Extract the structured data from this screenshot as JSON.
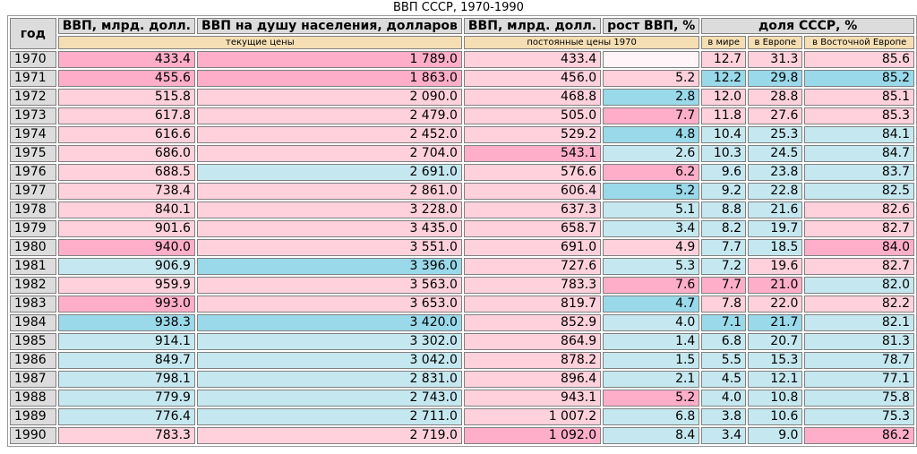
{
  "title": "ВВП СССР, 1970-1990",
  "headers": {
    "year": "год",
    "gdp_current": "ВВП, млрд. долл.",
    "gdp_per_capita": "ВВП на душу населения, долларов",
    "gdp_constant": "ВВП, млрд. долл.",
    "growth": "рост ВВП, %",
    "share": "доля СССР, %",
    "current_prices": "текущие цены",
    "constant_prices": "постоянные цены 1970",
    "share_world": "в мире",
    "share_europe": "в Европе",
    "share_east_europe": "в Восточной Европе"
  },
  "rows": [
    {
      "year": "1970",
      "gdp": "433.4",
      "pc": "1 789.0",
      "const": "433.4",
      "growth": "",
      "world": "12.7",
      "europe": "31.3",
      "east": "85.6",
      "cls": [
        "c-hot",
        "c-hot",
        "c-pink",
        "c-white",
        "c-pink",
        "c-pink",
        "c-pink"
      ]
    },
    {
      "year": "1971",
      "gdp": "455.6",
      "pc": "1 863.0",
      "const": "456.0",
      "growth": "5.2",
      "world": "12.2",
      "europe": "29.8",
      "east": "85.2",
      "cls": [
        "c-hot",
        "c-hot",
        "c-pink",
        "c-pink",
        "c-deep",
        "c-deep",
        "c-deep"
      ]
    },
    {
      "year": "1972",
      "gdp": "515.8",
      "pc": "2 090.0",
      "const": "468.8",
      "growth": "2.8",
      "world": "12.0",
      "europe": "28.8",
      "east": "85.1",
      "cls": [
        "c-pink",
        "c-pink",
        "c-pink",
        "c-deep",
        "c-pink",
        "c-pink",
        "c-pink"
      ]
    },
    {
      "year": "1973",
      "gdp": "617.8",
      "pc": "2 479.0",
      "const": "505.0",
      "growth": "7.7",
      "world": "11.8",
      "europe": "27.6",
      "east": "85.3",
      "cls": [
        "c-pink",
        "c-pink",
        "c-pink",
        "c-hot",
        "c-pink",
        "c-pink",
        "c-pink"
      ]
    },
    {
      "year": "1974",
      "gdp": "616.6",
      "pc": "2 452.0",
      "const": "529.2",
      "growth": "4.8",
      "world": "10.4",
      "europe": "25.3",
      "east": "84.1",
      "cls": [
        "c-pink",
        "c-pink",
        "c-pink",
        "c-deep",
        "c-blue",
        "c-blue",
        "c-blue"
      ]
    },
    {
      "year": "1975",
      "gdp": "686.0",
      "pc": "2 704.0",
      "const": "543.1",
      "growth": "2.6",
      "world": "10.3",
      "europe": "24.5",
      "east": "84.7",
      "cls": [
        "c-pink",
        "c-pink",
        "c-hot",
        "c-blue",
        "c-blue",
        "c-blue",
        "c-blue"
      ]
    },
    {
      "year": "1976",
      "gdp": "688.5",
      "pc": "2 691.0",
      "const": "576.6",
      "growth": "6.2",
      "world": "9.6",
      "europe": "23.8",
      "east": "83.7",
      "cls": [
        "c-pink",
        "c-blue",
        "c-pink",
        "c-hot",
        "c-blue",
        "c-blue",
        "c-blue"
      ]
    },
    {
      "year": "1977",
      "gdp": "738.4",
      "pc": "2 861.0",
      "const": "606.4",
      "growth": "5.2",
      "world": "9.2",
      "europe": "22.8",
      "east": "82.5",
      "cls": [
        "c-pink",
        "c-pink",
        "c-pink",
        "c-deep",
        "c-blue",
        "c-blue",
        "c-blue"
      ]
    },
    {
      "year": "1978",
      "gdp": "840.1",
      "pc": "3 228.0",
      "const": "637.3",
      "growth": "5.1",
      "world": "8.8",
      "europe": "21.6",
      "east": "82.6",
      "cls": [
        "c-pink",
        "c-pink",
        "c-pink",
        "c-blue",
        "c-blue",
        "c-blue",
        "c-pink"
      ]
    },
    {
      "year": "1979",
      "gdp": "901.6",
      "pc": "3 435.0",
      "const": "658.7",
      "growth": "3.4",
      "world": "8.2",
      "europe": "19.7",
      "east": "82.7",
      "cls": [
        "c-pink",
        "c-pink",
        "c-pink",
        "c-blue",
        "c-blue",
        "c-blue",
        "c-pink"
      ]
    },
    {
      "year": "1980",
      "gdp": "940.0",
      "pc": "3 551.0",
      "const": "691.0",
      "growth": "4.9",
      "world": "7.7",
      "europe": "18.5",
      "east": "84.0",
      "cls": [
        "c-hot",
        "c-pink",
        "c-pink",
        "c-pink",
        "c-blue",
        "c-blue",
        "c-hot"
      ]
    },
    {
      "year": "1981",
      "gdp": "906.9",
      "pc": "3 396.0",
      "const": "727.6",
      "growth": "5.3",
      "world": "7.2",
      "europe": "19.6",
      "east": "82.7",
      "cls": [
        "c-blue",
        "c-deep",
        "c-pink",
        "c-blue",
        "c-blue",
        "c-pink",
        "c-pink"
      ]
    },
    {
      "year": "1982",
      "gdp": "959.9",
      "pc": "3 563.0",
      "const": "783.3",
      "growth": "7.6",
      "world": "7.7",
      "europe": "21.0",
      "east": "82.0",
      "cls": [
        "c-pink",
        "c-pink",
        "c-pink",
        "c-hot",
        "c-hot",
        "c-hot",
        "c-blue"
      ]
    },
    {
      "year": "1983",
      "gdp": "993.0",
      "pc": "3 653.0",
      "const": "819.7",
      "growth": "4.7",
      "world": "7.8",
      "europe": "22.0",
      "east": "82.2",
      "cls": [
        "c-hot",
        "c-pink",
        "c-pink",
        "c-deep",
        "c-pink",
        "c-pink",
        "c-pink"
      ]
    },
    {
      "year": "1984",
      "gdp": "938.3",
      "pc": "3 420.0",
      "const": "852.9",
      "growth": "4.0",
      "world": "7.1",
      "europe": "21.7",
      "east": "82.1",
      "cls": [
        "c-deep",
        "c-deep",
        "c-pink",
        "c-blue",
        "c-deep",
        "c-deep",
        "c-blue"
      ]
    },
    {
      "year": "1985",
      "gdp": "914.1",
      "pc": "3 302.0",
      "const": "864.9",
      "growth": "1.4",
      "world": "6.8",
      "europe": "20.7",
      "east": "81.3",
      "cls": [
        "c-blue",
        "c-blue",
        "c-pink",
        "c-blue",
        "c-blue",
        "c-blue",
        "c-blue"
      ]
    },
    {
      "year": "1986",
      "gdp": "849.7",
      "pc": "3 042.0",
      "const": "878.2",
      "growth": "1.5",
      "world": "5.5",
      "europe": "15.3",
      "east": "78.7",
      "cls": [
        "c-blue",
        "c-blue",
        "c-pink",
        "c-blue",
        "c-blue",
        "c-blue",
        "c-blue"
      ]
    },
    {
      "year": "1987",
      "gdp": "798.1",
      "pc": "2 831.0",
      "const": "896.4",
      "growth": "2.1",
      "world": "4.5",
      "europe": "12.1",
      "east": "77.1",
      "cls": [
        "c-blue",
        "c-blue",
        "c-pink",
        "c-blue",
        "c-blue",
        "c-blue",
        "c-blue"
      ]
    },
    {
      "year": "1988",
      "gdp": "779.9",
      "pc": "2 743.0",
      "const": "943.1",
      "growth": "5.2",
      "world": "4.0",
      "europe": "10.8",
      "east": "75.8",
      "cls": [
        "c-blue",
        "c-blue",
        "c-pink",
        "c-hot",
        "c-blue",
        "c-blue",
        "c-blue"
      ]
    },
    {
      "year": "1989",
      "gdp": "776.4",
      "pc": "2 711.0",
      "const": "1 007.2",
      "growth": "6.8",
      "world": "3.8",
      "europe": "10.6",
      "east": "75.3",
      "cls": [
        "c-blue",
        "c-blue",
        "c-pink",
        "c-blue",
        "c-blue",
        "c-blue",
        "c-blue"
      ]
    },
    {
      "year": "1990",
      "gdp": "783.3",
      "pc": "2 719.0",
      "const": "1 092.0",
      "growth": "8.4",
      "world": "3.4",
      "europe": "9.0",
      "east": "86.2",
      "cls": [
        "c-pink",
        "c-pink",
        "c-hot",
        "c-blue",
        "c-blue",
        "c-blue",
        "c-hot"
      ]
    }
  ]
}
